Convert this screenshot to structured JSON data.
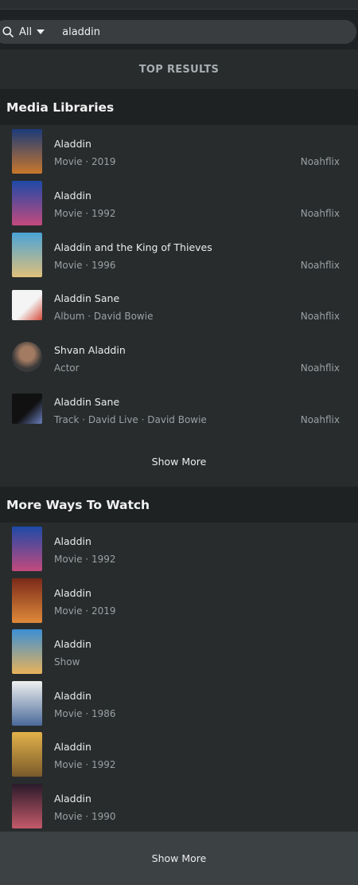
{
  "search": {
    "scope": "All",
    "query": "aladdin"
  },
  "top_results_label": "TOP RESULTS",
  "media_libraries": {
    "title": "Media Libraries",
    "items": [
      {
        "title": "Aladdin",
        "subtitle": "Movie · 2019",
        "library": "Noahflix",
        "thumb": "poster",
        "colors": [
          "#1b3a7a",
          "#c9772b"
        ]
      },
      {
        "title": "Aladdin",
        "subtitle": "Movie · 1992",
        "library": "Noahflix",
        "thumb": "poster",
        "colors": [
          "#1e4aa8",
          "#c34a7e"
        ]
      },
      {
        "title": "Aladdin and the King of Thieves",
        "subtitle": "Movie · 1996",
        "library": "Noahflix",
        "thumb": "poster",
        "colors": [
          "#4aa3d6",
          "#e0c07a"
        ]
      },
      {
        "title": "Aladdin Sane",
        "subtitle": "Album · David Bowie",
        "library": "Noahflix",
        "thumb": "album",
        "colors": [
          "#f4f4f4",
          "#d44a3a"
        ]
      },
      {
        "title": "Shvan Aladdin",
        "subtitle": "Actor",
        "library": "Noahflix",
        "thumb": "avatar",
        "colors": [
          "#3a3a3a",
          "#a37b62"
        ]
      },
      {
        "title": "Aladdin Sane",
        "subtitle": "Track · David Live · David Bowie",
        "library": "Noahflix",
        "thumb": "album",
        "colors": [
          "#111111",
          "#6a7fbf"
        ]
      }
    ],
    "show_more": "Show More"
  },
  "more_ways": {
    "title": "More Ways To Watch",
    "items": [
      {
        "title": "Aladdin",
        "subtitle": "Movie · 1992",
        "thumb": "poster",
        "colors": [
          "#1e4aa8",
          "#c34a7e"
        ]
      },
      {
        "title": "Aladdin",
        "subtitle": "Movie · 2019",
        "thumb": "poster",
        "colors": [
          "#7a2a1a",
          "#e08a3a"
        ]
      },
      {
        "title": "Aladdin",
        "subtitle": "Show",
        "thumb": "poster",
        "colors": [
          "#3c8fd4",
          "#e8b35a"
        ]
      },
      {
        "title": "Aladdin",
        "subtitle": "Movie · 1986",
        "thumb": "poster",
        "colors": [
          "#f0f0f0",
          "#4a6a9a"
        ]
      },
      {
        "title": "Aladdin",
        "subtitle": "Movie · 1992",
        "thumb": "poster",
        "colors": [
          "#e2b24a",
          "#7a5a2a"
        ]
      },
      {
        "title": "Aladdin",
        "subtitle": "Movie · 1990",
        "thumb": "poster",
        "colors": [
          "#2a1a2a",
          "#c45a6a"
        ]
      }
    ],
    "show_more": "Show More"
  }
}
